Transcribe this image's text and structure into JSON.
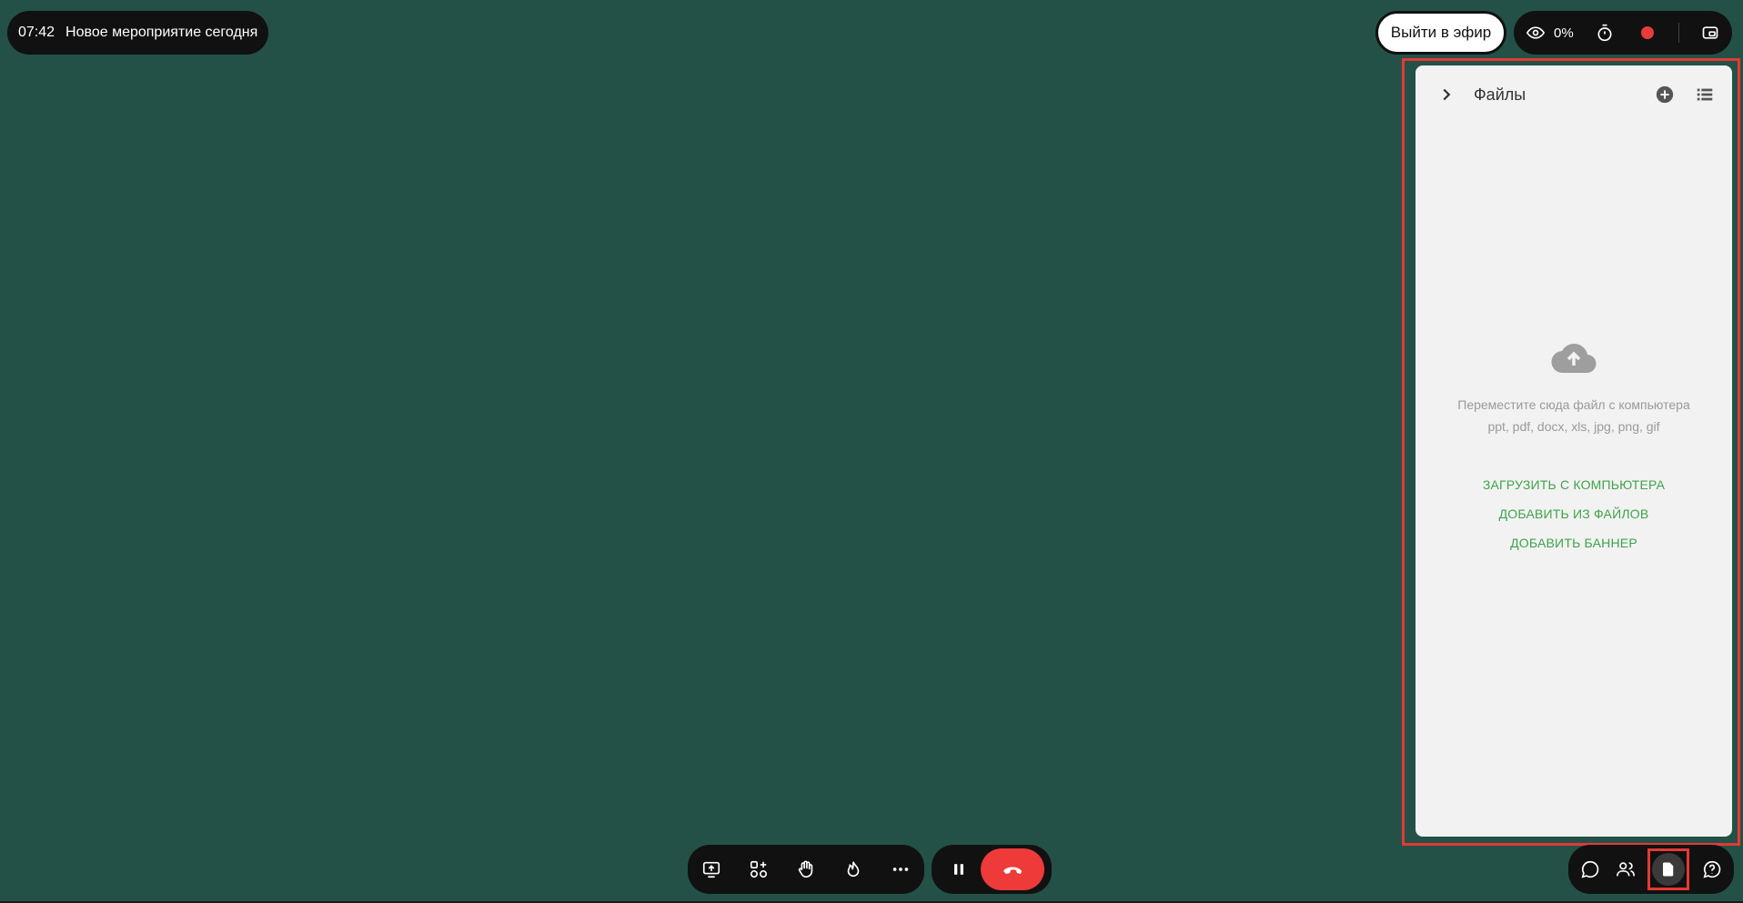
{
  "event": {
    "time": "07:42",
    "title": "Новое мероприятие сегодня"
  },
  "header": {
    "go_live_label": "Выйти в эфир",
    "viewers_percent": "0%",
    "icons": [
      "eye-icon",
      "timer-icon",
      "record-icon",
      "picture-in-picture-icon"
    ],
    "record_color": "#ea3b3b"
  },
  "files_panel": {
    "title": "Файлы",
    "hint_line1": "Переместите сюда файл с компьютера",
    "hint_line2": "ppt, pdf, docx, xls, jpg, png, gif",
    "upload_label": "ЗАГРУЗИТЬ С КОМПЬЮТЕРА",
    "add_from_files_label": "ДОБАВИТЬ ИЗ ФАЙЛОВ",
    "add_banner_label": "ДОБАВИТЬ БАННЕР",
    "link_color": "#3fa34a"
  },
  "toolbar": {
    "icons": [
      "screen-share-icon",
      "apps-add-icon",
      "raise-hand-icon",
      "reaction-icon",
      "more-icon"
    ]
  },
  "call": {
    "icons": [
      "pause-icon",
      "hangup-icon"
    ],
    "hangup_color": "#ef3a3a"
  },
  "side_toolbar": {
    "icons": [
      "chat-icon",
      "participants-icon",
      "files-icon",
      "help-icon"
    ]
  },
  "colors": {
    "background": "#235147",
    "highlight": "#e53935"
  }
}
